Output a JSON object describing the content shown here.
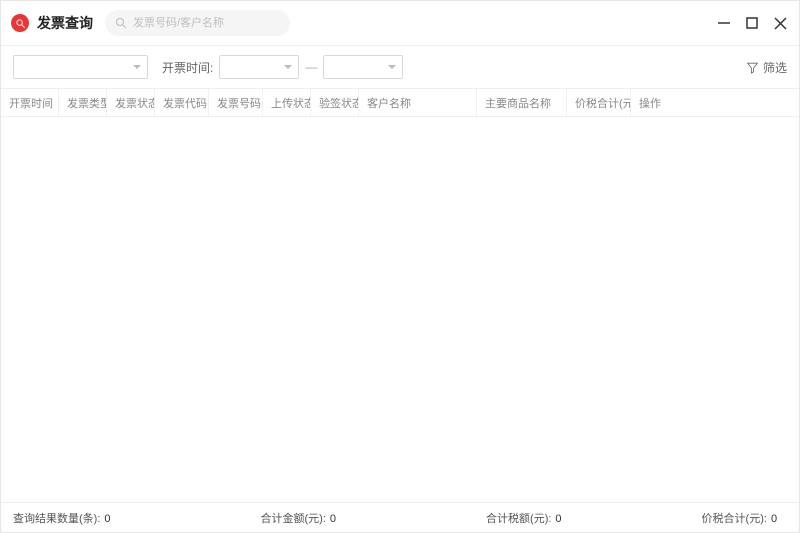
{
  "header": {
    "title": "发票查询",
    "search_placeholder": "发票号码/客户名称"
  },
  "filters": {
    "select_main": "",
    "time_label": "开票时间:",
    "date_from": "",
    "date_separator": "—",
    "date_to": "",
    "filter_button": "筛选"
  },
  "table": {
    "columns": [
      "开票时间",
      "发票类型",
      "发票状态",
      "发票代码",
      "发票号码",
      "上传状态",
      "验签状态",
      "客户名称",
      "主要商品名称",
      "价税合计(元)",
      "操作"
    ],
    "rows": []
  },
  "footer": {
    "count_label": "查询结果数量(条):",
    "count_value": "0",
    "amount_label": "合计金额(元):",
    "amount_value": "0",
    "tax_label": "合计税额(元):",
    "tax_value": "0",
    "total_label": "价税合计(元):",
    "total_value": "0"
  }
}
